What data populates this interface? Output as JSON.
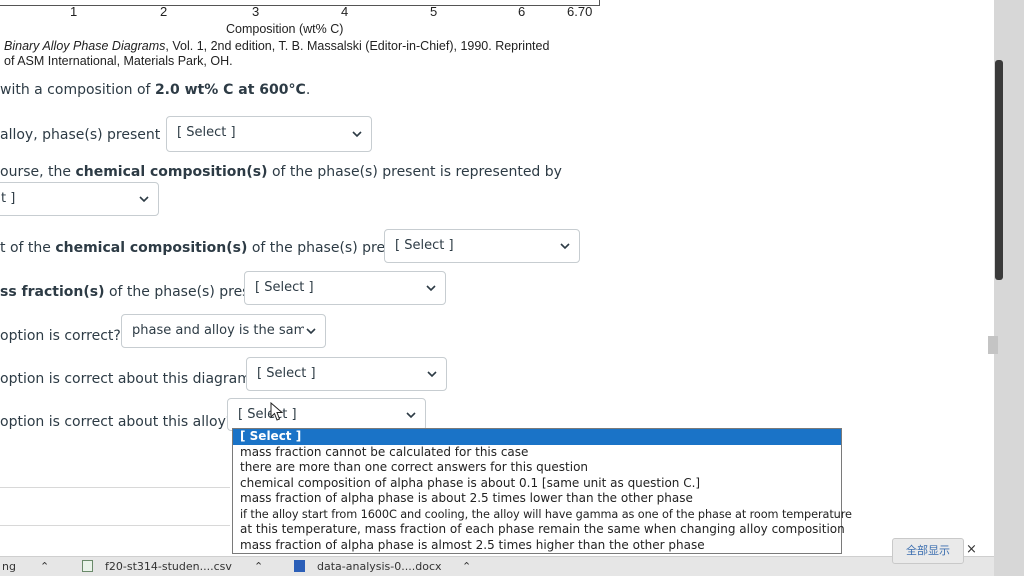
{
  "axis": {
    "ticks": [
      "1",
      "2",
      "3",
      "4",
      "5",
      "6",
      "6.70"
    ],
    "title": "Composition (wt% C)"
  },
  "caption": {
    "line1_ital": "Binary Alloy Phase Diagrams",
    "line1_rest": ", Vol. 1, 2nd edition, T. B. Massalski (Editor-in-Chief), 1990. Reprinted",
    "line2": "of ASM International, Materials Park, OH."
  },
  "intro": {
    "prefix": "with a composition of ",
    "bold": "2.0 wt% C at 600°C",
    "suffix": "."
  },
  "questions": [
    {
      "pre": "alloy, phase(s) present is",
      "bold": "",
      "post": "",
      "select": "[ Select ]"
    },
    {
      "pre": "ourse, the ",
      "bold": "chemical composition(s)",
      "post": " of the phase(s) present is represented by",
      "select": "t ]"
    },
    {
      "pre": "t of the ",
      "bold": "chemical composition(s)",
      "post": " of the phase(s) present is",
      "select": "[ Select ]"
    },
    {
      "pre": "",
      "bold": "ss fraction(s)",
      "post": " of the phase(s) present",
      "select": "[ Select ]"
    },
    {
      "pre": " option is correct?",
      "bold": "",
      "post": "",
      "select": "phase and alloy is the same th"
    },
    {
      "pre": " option is correct about this diagram?",
      "bold": "",
      "post": "",
      "select": "[ Select ]"
    },
    {
      "pre": " option is correct about this alloy?",
      "bold": "",
      "post": "",
      "select": "[ Select ]"
    }
  ],
  "dropdown": {
    "options": [
      "[ Select ]",
      "mass fraction cannot be calculated for this case",
      "there are more than one correct answers for this question",
      "chemical composition of alpha phase is about 0.1 [same unit as question C.]",
      "mass fraction of alpha phase is about 2.5 times lower than the other phase",
      "if the alloy start from 1600C and cooling, the alloy will have gamma as one of the phase at room temperature",
      "at this temperature, mass fraction of each phase remain the same when changing alloy composition",
      "mass fraction of alpha phase is almost 2.5 times higher than the other phase"
    ],
    "selected_index": 0,
    "accent": "#1a73c7"
  },
  "downloads": {
    "left_cut": "ng",
    "items": [
      "f20-st314-studen....csv",
      "data-analysis-0....docx"
    ]
  },
  "show_all": "全部显示",
  "close": "×"
}
